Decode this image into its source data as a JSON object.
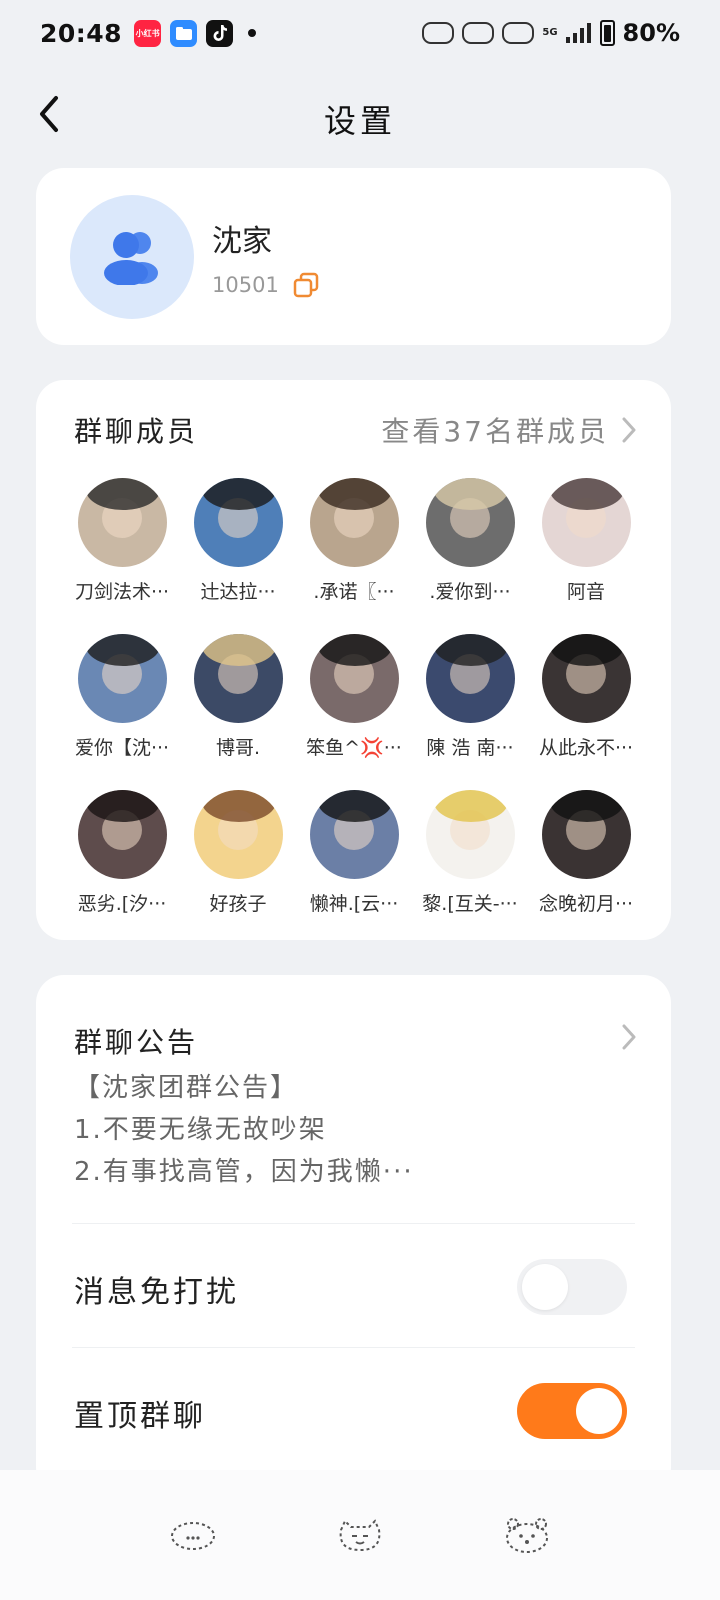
{
  "status_bar": {
    "time": "20:48",
    "apps": [
      {
        "icon": "xiaohongshu-icon",
        "label": "小红书",
        "color": "#ff2442"
      },
      {
        "icon": "files-icon",
        "label": "",
        "color": "#2f8cff"
      },
      {
        "icon": "tiktok-icon",
        "label": "",
        "color": "#111111"
      }
    ],
    "network": "5G",
    "battery": "80%"
  },
  "header": {
    "title": "设置",
    "back_icon": "chevron-left-icon"
  },
  "group": {
    "name": "沈家",
    "id": "10501",
    "avatar_icon": "group-users-icon",
    "copy_icon": "copy-icon",
    "accent_color": "#f08a32"
  },
  "members_section": {
    "title": "群聊成员",
    "link": "查看37名群成员",
    "members": [
      {
        "name": "刀剑法术···",
        "color": "#c9b8a4",
        "hair": "#2a2a2a"
      },
      {
        "name": "辻达拉···",
        "color": "#4f7fb8",
        "hair": "#1a1a1a"
      },
      {
        "name": ".承诺〖···",
        "color": "#b9a58e",
        "hair": "#3a2a20"
      },
      {
        "name": ".爱你到···",
        "color": "#6d6d6d",
        "hair": "#d8c9a8"
      },
      {
        "name": "阿音",
        "color": "#e4d6d4",
        "hair": "#4a3b3b"
      },
      {
        "name": "爱你【沈···",
        "color": "#6a88b4",
        "hair": "#1e1e1e"
      },
      {
        "name": "博哥.",
        "color": "#3c4a66",
        "hair": "#e0c48a"
      },
      {
        "name": "笨鱼^💢···",
        "color": "#7a6a6a",
        "hair": "#151515"
      },
      {
        "name": "陳 浩 南···",
        "color": "#3b4a6e",
        "hair": "#202020"
      },
      {
        "name": "从此永不···",
        "color": "#3a3434",
        "hair": "#121212"
      },
      {
        "name": "恶劣.[汐···",
        "color": "#5e4c4c",
        "hair": "#1a1414"
      },
      {
        "name": "好孩子",
        "color": "#f3d48e",
        "hair": "#7a4a2a"
      },
      {
        "name": "懒神.[云···",
        "color": "#6b7fa6",
        "hair": "#141414"
      },
      {
        "name": "黎.[互关-···",
        "color": "#f4f2ee",
        "hair": "#e2c34a"
      },
      {
        "name": "念晚初月···",
        "color": "#3a3333",
        "hair": "#111111"
      }
    ]
  },
  "notice": {
    "title": "群聊公告",
    "lines": [
      "【沈家团群公告】",
      "1.不要无缘无故吵架",
      "2.有事找高管，因为我懒···"
    ]
  },
  "settings": {
    "dnd_label": "消息免打扰",
    "dnd_on": false,
    "pin_label": "置顶群聊",
    "pin_on": true,
    "accent": "#ff7a1a"
  },
  "bottom_nav": {
    "buttons": [
      "back-nav-icon",
      "home-nav-icon",
      "recents-nav-icon"
    ]
  }
}
